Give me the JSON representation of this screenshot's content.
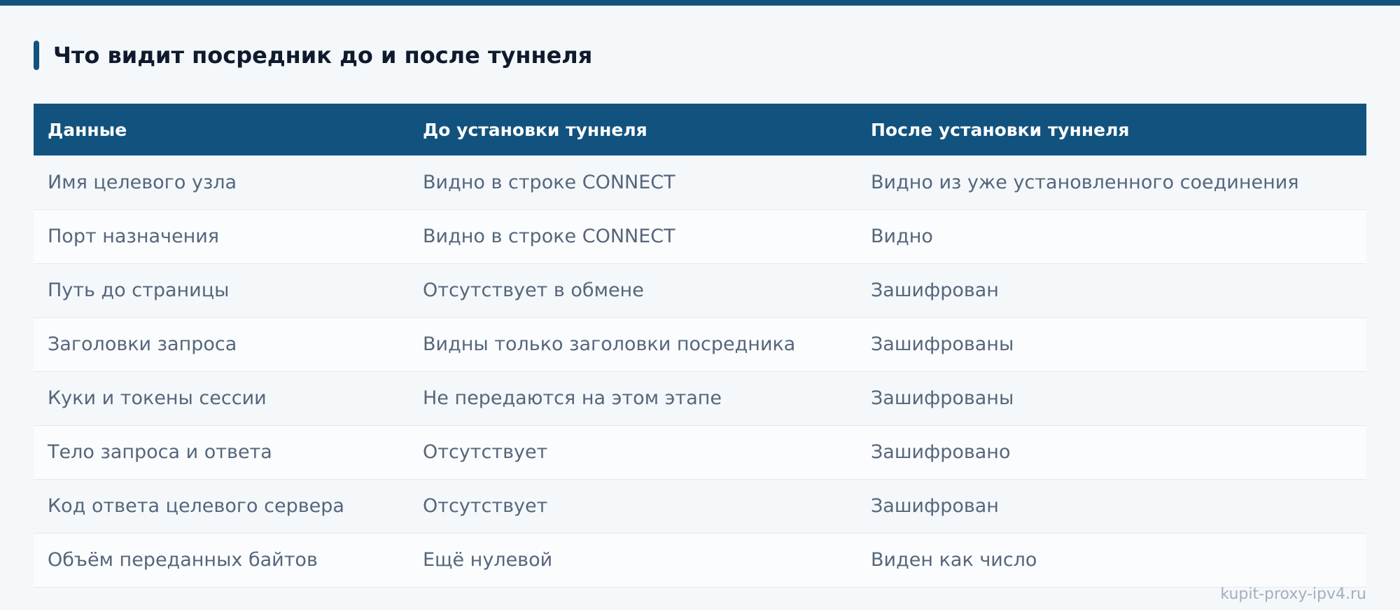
{
  "section": {
    "title": "Что видит посредник до и после туннеля"
  },
  "table": {
    "headers": [
      "Данные",
      "До установки туннеля",
      "После установки туннеля"
    ],
    "rows": [
      [
        "Имя целевого узла",
        "Видно в строке CONNECT",
        "Видно из уже установленного соединения"
      ],
      [
        "Порт назначения",
        "Видно в строке CONNECT",
        "Видно"
      ],
      [
        "Путь до страницы",
        "Отсутствует в обмене",
        "Зашифрован"
      ],
      [
        "Заголовки запроса",
        "Видны только заголовки посредника",
        "Зашифрованы"
      ],
      [
        "Куки и токены сессии",
        "Не передаются на этом этапе",
        "Зашифрованы"
      ],
      [
        "Тело запроса и ответа",
        "Отсутствует",
        "Зашифровано"
      ],
      [
        "Код ответа целевого сервера",
        "Отсутствует",
        "Зашифрован"
      ],
      [
        "Объём переданных байтов",
        "Ещё нулевой",
        "Виден как число"
      ]
    ]
  },
  "footer": {
    "watermark": "kupit-proxy-ipv4.ru"
  },
  "colors": {
    "accent": "#12527e",
    "heading_text": "#0f1b2d",
    "cell_text": "#56667a",
    "background": "#f4f8fb"
  }
}
